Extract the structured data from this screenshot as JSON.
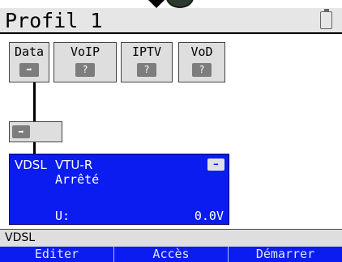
{
  "header": {
    "title": "Profil 1"
  },
  "services": [
    {
      "label": "Data",
      "icon": "arrow-right-icon",
      "glyph": "➡"
    },
    {
      "label": "VoIP",
      "icon": "question-icon",
      "glyph": "?"
    },
    {
      "label": "IPTV",
      "icon": "question-icon",
      "glyph": "?"
    },
    {
      "label": "VoD",
      "icon": "question-icon",
      "glyph": "?"
    }
  ],
  "middle": {
    "glyph": "➡"
  },
  "vdsl_block": {
    "title": "VDSL",
    "mode": "VTU-R",
    "state": "Arrêté",
    "voltage_label": "U:",
    "voltage_value": "0.0V",
    "glyph": "➡"
  },
  "status_bar": {
    "text": "VDSL"
  },
  "softkeys": [
    "Editer",
    "Accès",
    "Démarrer"
  ],
  "colors": {
    "accent": "#0a1cf0",
    "panel": "#dedede"
  }
}
